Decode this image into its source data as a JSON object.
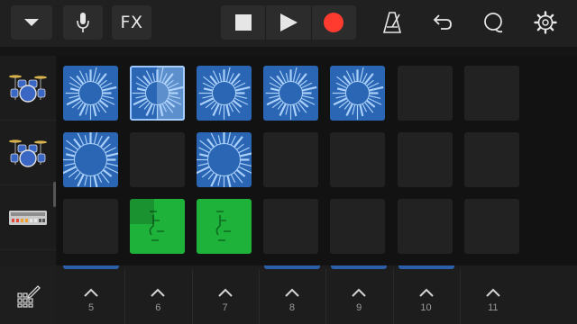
{
  "toolbar": {
    "fx_label": "FX",
    "colors": {
      "record": "#ff3b30",
      "bar_bg": "#202020",
      "button_bg": "#2c2c2c"
    }
  },
  "icons": {
    "browser": "chevron-down-icon",
    "input": "microphone-icon",
    "effects": "fx-icon",
    "stop": "stop-icon",
    "play": "play-icon",
    "record": "record-icon",
    "metronome": "metronome-icon",
    "undo": "undo-icon",
    "loop": "loop-browser-icon",
    "settings": "gear-icon",
    "edit": "grid-edit-icon",
    "track_instruments": [
      "drum-kit-icon",
      "drum-kit-icon",
      "drum-machine-icon"
    ]
  },
  "grid": {
    "rows": [
      {
        "cells": [
          "blue",
          "blue-selected",
          "blue",
          "blue",
          "blue",
          "empty",
          "empty"
        ]
      },
      {
        "cells": [
          "blue",
          "empty",
          "blue",
          "empty",
          "empty",
          "empty",
          "empty"
        ]
      },
      {
        "cells": [
          "empty",
          "green",
          "green",
          "empty",
          "empty",
          "empty",
          "empty"
        ]
      }
    ],
    "colors": {
      "audio_cell": "#2a66b3",
      "midi_cell": "#1fb23a",
      "empty_cell": "#222222"
    }
  },
  "columns": {
    "labels": [
      "5",
      "6",
      "7",
      "8",
      "9",
      "10",
      "11"
    ],
    "has_clips_below": [
      true,
      false,
      false,
      true,
      true,
      true,
      false
    ]
  }
}
